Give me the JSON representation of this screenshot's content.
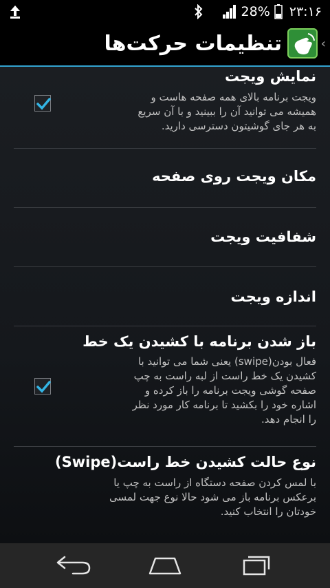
{
  "status_bar": {
    "battery_percent": "28%",
    "time": "۲۳:۱۶",
    "icons": [
      "upload-icon",
      "bluetooth-icon",
      "signal-icon",
      "battery-icon"
    ]
  },
  "action_bar": {
    "title": "تنظیمات حرکت‌ها",
    "icons": [
      "back-chevron-icon",
      "app-logo-icon"
    ]
  },
  "preferences": [
    {
      "title": "نمایش ویجت",
      "summary": [
        "ویجت برنامه بالای همه صفحه هاست و",
        "همیشه می توانید آن را ببینید و با آن سریع",
        "به هر جای گوشیتون دسترسی دارید."
      ],
      "checked": true
    },
    {
      "title": "مکان ویجت روی صفحه"
    },
    {
      "title": "شفافیت ویجت"
    },
    {
      "title": "اندازه ویجت"
    },
    {
      "title": "باز شدن برنامه با کشیدن یک خط",
      "summary": [
        "فعال بودن(swipe) یعنی شما می توانید با",
        "کشیدن یک خط راست از لبه راست به چپ",
        "صفحه گوشی ویجت برنامه را باز کرده و",
        "اشاره خود را بکشید تا برنامه کار مورد نظر",
        "را انجام دهد."
      ],
      "checked": true
    },
    {
      "title": "نوع حالت کشیدن خط راست(Swipe)",
      "summary": [
        "با لمس کردن صفحه دستگاه از راست به چپ یا",
        "برعکس برنامه باز می شود حالا نوع جهت لمسی",
        "خودتان را انتخاب کنید."
      ]
    }
  ],
  "nav_bar": {
    "icons": [
      "back-icon",
      "home-icon",
      "recent-apps-icon"
    ]
  }
}
